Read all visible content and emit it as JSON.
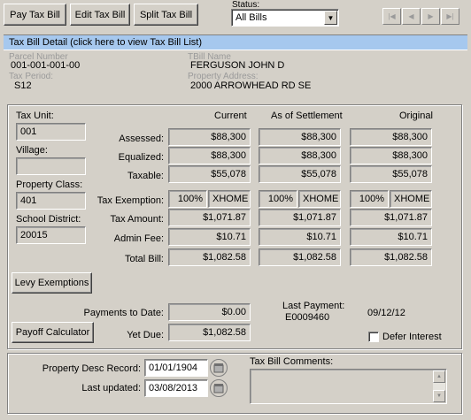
{
  "toolbar": {
    "pay": "Pay Tax Bill",
    "edit": "Edit Tax Bill",
    "split": "Split Tax Bill",
    "status_label": "Status:",
    "status_value": "All Bills"
  },
  "detail_header": "Tax Bill Detail (click here to view Tax Bill List)",
  "info": {
    "parcel_number_label": "Parcel Number",
    "parcel_number": "001-001-001-00",
    "tax_period_label": "Tax Period:",
    "tax_period": "S12",
    "tbill_name_label": "TBill Name",
    "tbill_name": "FERGUSON JOHN D",
    "property_address_label": "Property Address:",
    "property_address": "2000 ARROWHEAD RD SE"
  },
  "left": {
    "tax_unit_label": "Tax Unit:",
    "tax_unit": "001",
    "village_label": "Village:",
    "village": "",
    "property_class_label": "Property Class:",
    "property_class": "401",
    "school_district_label": "School District:",
    "school_district": "20015"
  },
  "columns": {
    "current": "Current",
    "settlement": "As of Settlement",
    "original": "Original"
  },
  "rows": {
    "assessed": "Assessed:",
    "equalized": "Equalized:",
    "taxable": "Taxable:",
    "exemption": "Tax Exemption:",
    "amount": "Tax Amount:",
    "admin": "Admin Fee:",
    "total": "Total Bill:"
  },
  "current": {
    "assessed": "$88,300",
    "equalized": "$88,300",
    "taxable": "$55,078",
    "exemption_pct": "100%",
    "exemption_code": "XHOME",
    "amount": "$1,071.87",
    "admin": "$10.71",
    "total": "$1,082.58"
  },
  "settlement": {
    "assessed": "$88,300",
    "equalized": "$88,300",
    "taxable": "$55,078",
    "exemption_pct": "100%",
    "exemption_code": "XHOME",
    "amount": "$1,071.87",
    "admin": "$10.71",
    "total": "$1,082.58"
  },
  "original": {
    "assessed": "$88,300",
    "equalized": "$88,300",
    "taxable": "$55,078",
    "exemption_pct": "100%",
    "exemption_code": "XHOME",
    "amount": "$1,071.87",
    "admin": "$10.71",
    "total": "$1,082.58"
  },
  "levy_button": "Levy Exemptions",
  "payoff_button": "Payoff Calculator",
  "payments_to_date_label": "Payments to Date:",
  "payments_to_date": "$0.00",
  "yet_due_label": "Yet Due:",
  "yet_due": "$1,082.58",
  "last_payment_label": "Last Payment:",
  "last_payment_id": "E0009460",
  "last_payment_date": "09/12/12",
  "defer_interest_label": "Defer Interest",
  "footer": {
    "property_desc_label": "Property Desc Record:",
    "property_desc_date": "01/01/1904",
    "last_updated_label": "Last updated:",
    "last_updated_date": "03/08/2013",
    "comments_label": "Tax Bill Comments:",
    "comments": ""
  },
  "icons": {
    "first": "first-record-icon",
    "prev": "prev-record-icon",
    "next": "next-record-icon",
    "last": "last-record-icon",
    "dropdown": "chevron-down-icon",
    "calendar": "calendar-icon"
  },
  "colors": {
    "header_bar": "#a6c8ee",
    "background": "#d4d0c8"
  }
}
